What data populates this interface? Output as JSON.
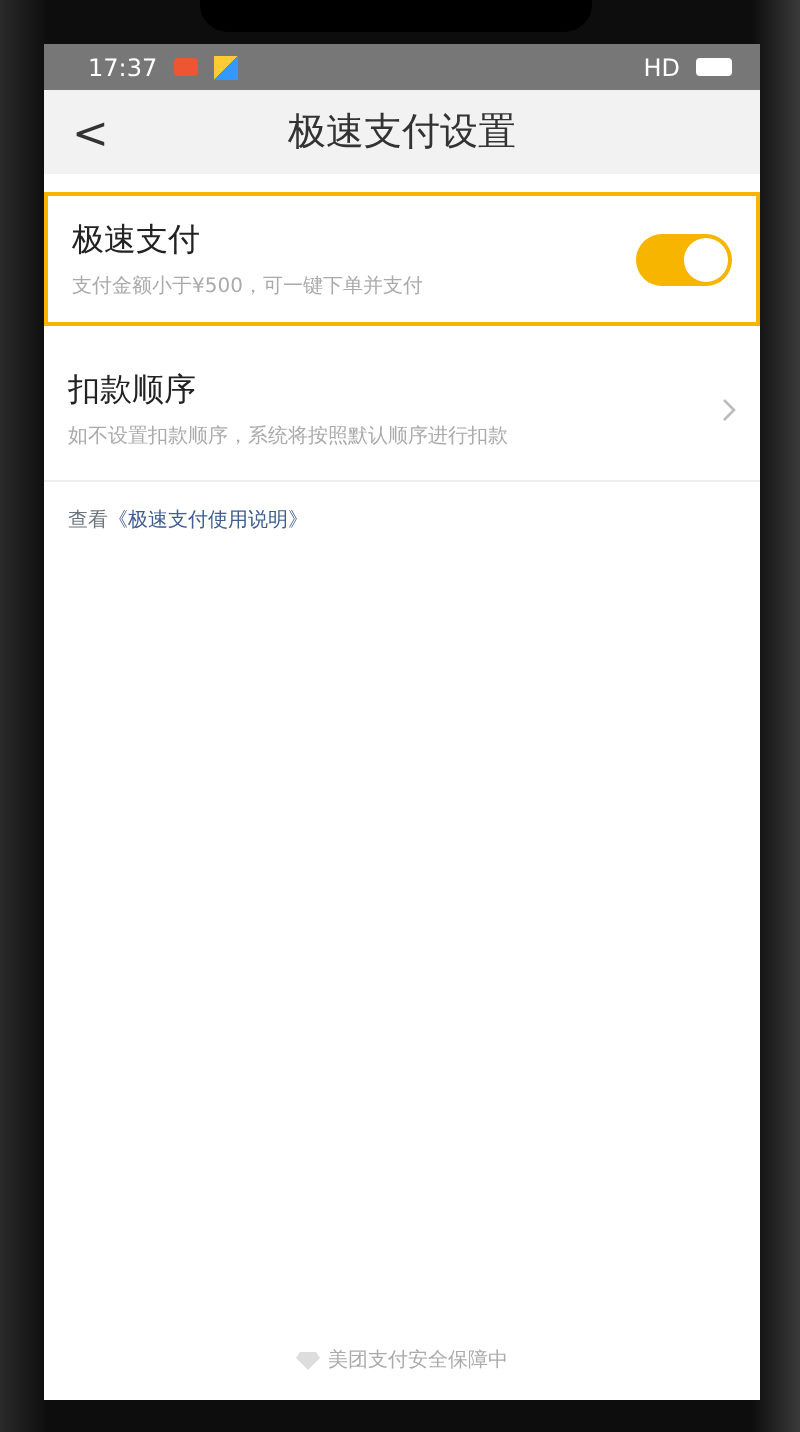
{
  "status_bar": {
    "time": "17:37",
    "network": "HD"
  },
  "nav": {
    "back": "<",
    "title": "极速支付设置"
  },
  "settings": [
    {
      "kind": "toggle",
      "title": "极速支付",
      "subtitle": "支付金额小于¥500，可一键下单并支付",
      "on": true,
      "highlighted": true
    },
    {
      "kind": "link",
      "title": "扣款顺序",
      "subtitle": "如不设置扣款顺序，系统将按照默认顺序进行扣款",
      "highlighted": false
    }
  ],
  "help": {
    "prefix": "查看",
    "link": "《极速支付使用说明》"
  },
  "footer": "美团支付安全保障中"
}
